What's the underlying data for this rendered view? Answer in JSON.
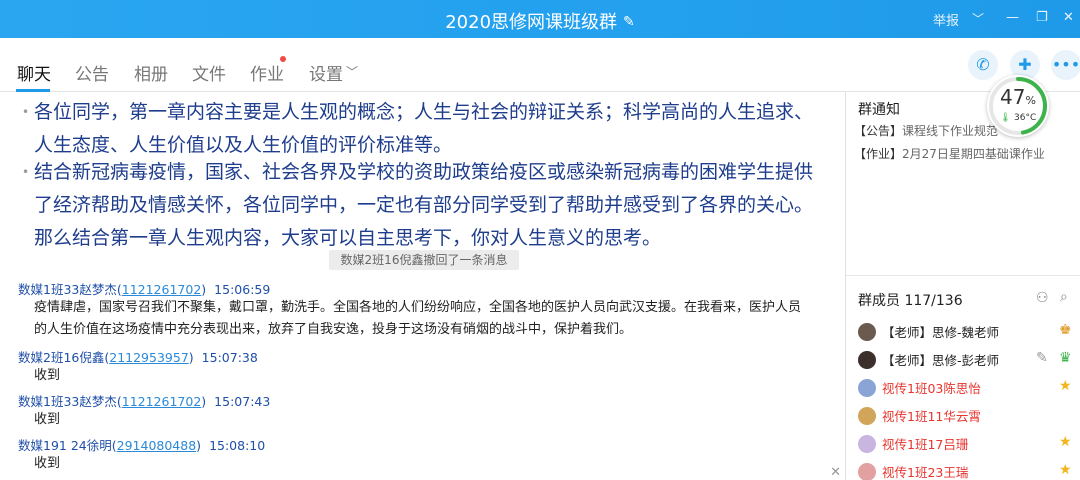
{
  "window": {
    "title": "2020思修网课班级群",
    "edit_icon": "pencil-icon",
    "report_label": "举报"
  },
  "tabs": [
    {
      "label": "聊天",
      "active": true
    },
    {
      "label": "公告"
    },
    {
      "label": "相册"
    },
    {
      "label": "文件"
    },
    {
      "label": "作业",
      "badge": true
    },
    {
      "label": "设置"
    }
  ],
  "chat": {
    "announcement": [
      "各位同学，第一章内容主要是人生观的概念；人生与社会的辩证关系；科学高尚的人生追求、人生态度、人生价值以及人生价值的评价标准等。",
      "结合新冠病毒疫情，国家、社会各界及学校的资助政策给疫区或感染新冠病毒的困难学生提供了经济帮助及情感关怀，各位同学中，一定也有部分同学受到了帮助并感受到了各界的关心。那么结合第一章人生观内容，大家可以自主思考下，你对人生意义的思考。"
    ],
    "recall_notice": "数媒2班16倪鑫撤回了一条消息",
    "messages": [
      {
        "sender": "数媒1班33赵梦杰",
        "qq": "1121261702",
        "time": "15:06:59",
        "lines": [
          "疫情肆虐，国家号召我们不聚集，戴口罩，勤洗手。全国各地的人们纷纷响应，全国各地的医护人员向武汉支援。在我看来，医护人员",
          "的人生价值在这场疫情中充分表现出来，放弃了自我安逸，投身于这场没有硝烟的战斗中，保护着我们。"
        ]
      },
      {
        "sender": "数媒2班16倪鑫",
        "qq": "2112953957",
        "time": "15:07:38",
        "lines": [
          "收到"
        ]
      },
      {
        "sender": "数媒1班33赵梦杰",
        "qq": "1121261702",
        "time": "15:07:43",
        "lines": [
          "收到"
        ]
      },
      {
        "sender": "数媒191 24徐明",
        "qq": "2914080488",
        "time": "15:08:10",
        "lines": [
          "收到"
        ]
      }
    ]
  },
  "side": {
    "notice_title": "群通知",
    "notices": [
      {
        "tag": "【公告】",
        "text": "课程线下作业规范"
      },
      {
        "tag": "【作业】",
        "text": "2月27日星期四基础课作业"
      }
    ],
    "members_title": "群成员 117/136",
    "members": [
      {
        "name": "【老师】思修-魏老师",
        "role": "teacher",
        "avatar_color": "#6b5a4e"
      },
      {
        "name": "【老师】思修-彭老师",
        "role": "teacher",
        "avatar_color": "#3a2f2a"
      },
      {
        "name": "视传1班03陈思怡",
        "role": "student",
        "avatar_color": "#8aa4d6"
      },
      {
        "name": "视传1班11华云霄",
        "role": "student",
        "avatar_color": "#d1a65a"
      },
      {
        "name": "视传1班17吕珊",
        "role": "student",
        "avatar_color": "#c9b6e0"
      },
      {
        "name": "视传1班23王瑞",
        "role": "student",
        "avatar_color": "#e3a0a0"
      }
    ]
  },
  "perf": {
    "percent": "47",
    "percent_unit": "%",
    "temperature": "36°C",
    "load": 0.47
  },
  "colors": {
    "accent": "#1e9ae9",
    "announcement_text": "#1e3d8c",
    "student_name": "#e8352f"
  }
}
